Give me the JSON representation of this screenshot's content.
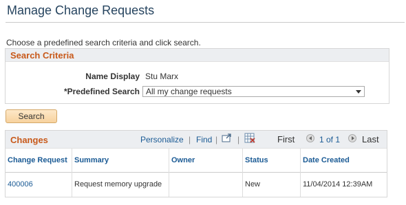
{
  "page_title": "Manage Change Requests",
  "instructions": "Choose a predefined search criteria and click search.",
  "search_criteria": {
    "header": "Search Criteria",
    "name_display_label": "Name Display",
    "name_display_value": "Stu Marx",
    "predefined_search_label": "*Predefined Search",
    "predefined_search_value": "All my change requests"
  },
  "search_button": "Search",
  "changes_grid": {
    "title": "Changes",
    "personalize": "Personalize",
    "find": "Find",
    "separator": "|",
    "first": "First",
    "range": "1 of 1",
    "last": "Last",
    "columns": {
      "change_request": "Change Request",
      "summary": "Summary",
      "owner": "Owner",
      "status": "Status",
      "date_created": "Date Created"
    },
    "rows": [
      {
        "change_request": "400006",
        "summary": "Request memory upgrade",
        "owner": "",
        "status": "New",
        "date_created": "11/04/2014 12:39AM"
      }
    ]
  },
  "colors": {
    "section_header": "#c8591a",
    "link": "#1a5a94",
    "title": "#26445f"
  }
}
